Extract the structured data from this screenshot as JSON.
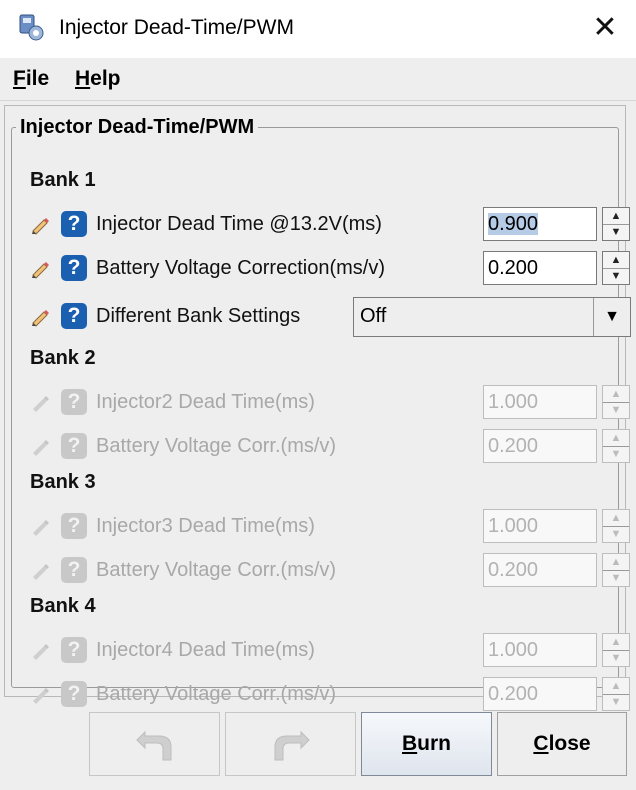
{
  "window": {
    "title": "Injector Dead-Time/PWM",
    "close_glyph": "✕"
  },
  "menu": {
    "file": {
      "mnemonic": "F",
      "rest": "ile"
    },
    "help": {
      "mnemonic": "H",
      "rest": "elp"
    }
  },
  "group": {
    "title": "Injector Dead-Time/PWM"
  },
  "bank1": {
    "title": "Bank 1",
    "dead_time": {
      "label": "Injector Dead Time @13.2V(ms)",
      "value": "0.900"
    },
    "batt_corr": {
      "label": "Battery Voltage Correction(ms/v)",
      "value": "0.200"
    },
    "diff_bank": {
      "label": "Different Bank Settings",
      "value": "Off"
    }
  },
  "bank2": {
    "title": "Bank 2",
    "dead_time": {
      "label": "Injector2 Dead Time(ms)",
      "value": "1.000"
    },
    "batt_corr": {
      "label": "Battery Voltage Corr.(ms/v)",
      "value": "0.200"
    }
  },
  "bank3": {
    "title": "Bank 3",
    "dead_time": {
      "label": "Injector3 Dead Time(ms)",
      "value": "1.000"
    },
    "batt_corr": {
      "label": "Battery Voltage Corr.(ms/v)",
      "value": "0.200"
    }
  },
  "bank4": {
    "title": "Bank 4",
    "dead_time": {
      "label": "Injector4 Dead Time(ms)",
      "value": "1.000"
    },
    "batt_corr": {
      "label": "Battery Voltage Corr.(ms/v)",
      "value": "0.200"
    }
  },
  "icons": {
    "help": "?",
    "spin_up": "▲",
    "spin_down": "▼",
    "dropdown": "▼"
  },
  "buttons": {
    "burn": {
      "mnemonic": "B",
      "rest": "urn"
    },
    "close": {
      "mnemonic": "C",
      "rest": "lose"
    }
  },
  "colors": {
    "accent": "#1a5fb0",
    "selection": "#b6cbe6",
    "disabled_text": "#a8a8a8"
  }
}
